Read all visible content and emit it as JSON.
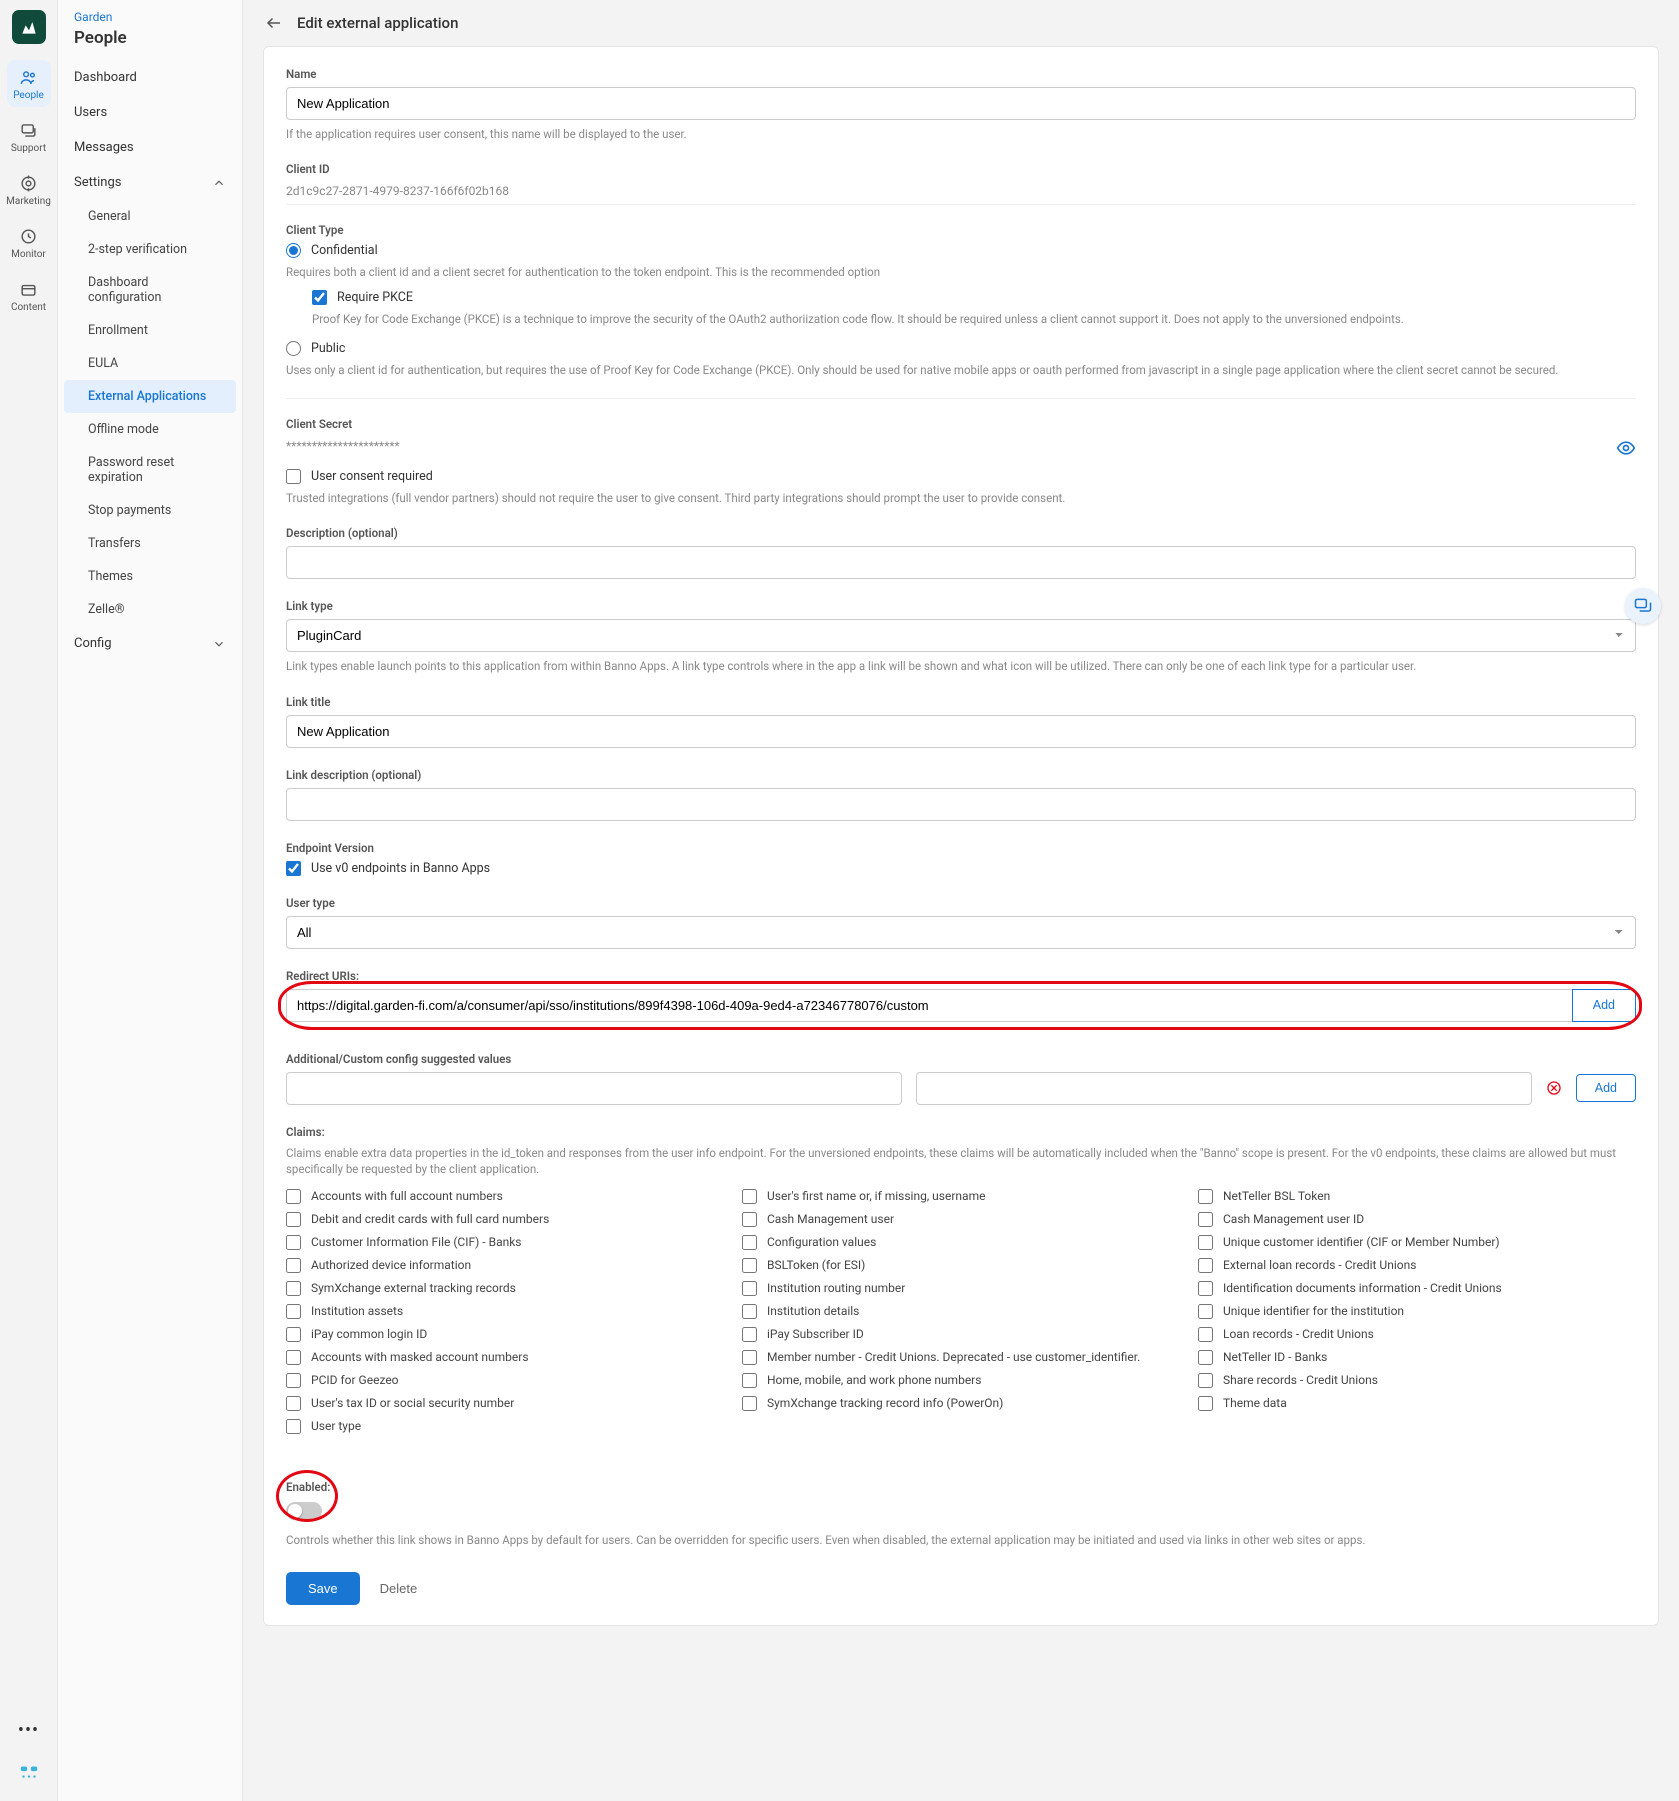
{
  "crumb": "Garden",
  "section": "People",
  "rail": [
    {
      "label": "People"
    },
    {
      "label": "Support"
    },
    {
      "label": "Marketing"
    },
    {
      "label": "Monitor"
    },
    {
      "label": "Content"
    }
  ],
  "nav": {
    "items": [
      "Dashboard",
      "Users",
      "Messages"
    ],
    "settings": {
      "label": "Settings",
      "children": [
        "General",
        "2-step verification",
        "Dashboard configuration",
        "Enrollment",
        "EULA",
        "External Applications",
        "Offline mode",
        "Password reset expiration",
        "Stop payments",
        "Transfers",
        "Themes",
        "Zelle®"
      ]
    },
    "config": {
      "label": "Config"
    }
  },
  "page_title": "Edit external application",
  "fields": {
    "name_label": "Name",
    "name_value": "New Application",
    "name_help": "If the application requires user consent, this name will be displayed to the user.",
    "client_id_label": "Client ID",
    "client_id_value": "2d1c9c27-2871-4979-8237-166f6f02b168",
    "client_type_label": "Client Type",
    "confidential": "Confidential",
    "confidential_help": "Requires both a client id and a client secret for authentication to the token endpoint. This is the recommended option",
    "require_pkce": "Require PKCE",
    "pkce_help": "Proof Key for Code Exchange (PKCE) is a technique to improve the security of the OAuth2 authoriization code flow. It should be required unless a client cannot support it. Does not apply to the unversioned endpoints.",
    "public": "Public",
    "public_help": "Uses only a client id for authentication, but requires the use of Proof Key for Code Exchange (PKCE). Only should be used for native mobile apps or oauth performed from javascript in a single page application where the client secret cannot be secured.",
    "client_secret_label": "Client Secret",
    "client_secret_value": "**********************",
    "consent_label": "User consent required",
    "consent_help": "Trusted integrations (full vendor partners) should not require the user to give consent. Third party integrations should prompt the user to provide consent.",
    "description_label": "Description (optional)",
    "link_type_label": "Link type",
    "link_type_value": "PluginCard",
    "link_type_help": "Link types enable launch points to this application from within Banno Apps. A link type controls where in the app a link will be shown and what icon will be utilized. There can only be one of each link type for a particular user.",
    "link_title_label": "Link title",
    "link_title_value": "New Application",
    "link_desc_label": "Link description (optional)",
    "endpoint_label": "Endpoint Version",
    "endpoint_check": "Use v0 endpoints in Banno Apps",
    "user_type_label": "User type",
    "user_type_value": "All",
    "redirect_label": "Redirect URIs:",
    "redirect_value": "https://digital.garden-fi.com/a/consumer/api/sso/institutions/899f4398-106d-409a-9ed4-a72346778076/custom",
    "add_button": "Add",
    "config_label": "Additional/Custom config suggested values",
    "claims_label": "Claims:",
    "claims_help": "Claims enable extra data properties in the id_token and responses from the user info endpoint. For the unversioned endpoints, these claims will be automatically included when the \"Banno\" scope is present. For the v0 endpoints, these claims are allowed but must specifically be requested by the client application.",
    "claims": [
      "Accounts with full account numbers",
      "User's first name or, if missing, username",
      "NetTeller BSL Token",
      "Debit and credit cards with full card numbers",
      "Cash Management user",
      "Cash Management user ID",
      "Customer Information File (CIF) - Banks",
      "Configuration values",
      "Unique customer identifier (CIF or Member Number)",
      "Authorized device information",
      "BSLToken (for ESI)",
      "External loan records - Credit Unions",
      "SymXchange external tracking records",
      "Institution routing number",
      "Identification documents information - Credit Unions",
      "Institution assets",
      "Institution details",
      "Unique identifier for the institution",
      "iPay common login ID",
      "iPay Subscriber ID",
      "Loan records - Credit Unions",
      "Accounts with masked account numbers",
      "Member number - Credit Unions. Deprecated - use customer_identifier.",
      "NetTeller ID - Banks",
      "PCID for Geezeo",
      "Home, mobile, and work phone numbers",
      "Share records - Credit Unions",
      "User's tax ID or social security number",
      "SymXchange tracking record info (PowerOn)",
      "Theme data",
      "User type"
    ],
    "enabled_label": "Enabled:",
    "enabled_help": "Controls whether this link shows in Banno Apps by default for users. Can be overridden for specific users. Even when disabled, the external application may be initiated and used via links in other web sites or apps.",
    "save": "Save",
    "delete": "Delete"
  }
}
